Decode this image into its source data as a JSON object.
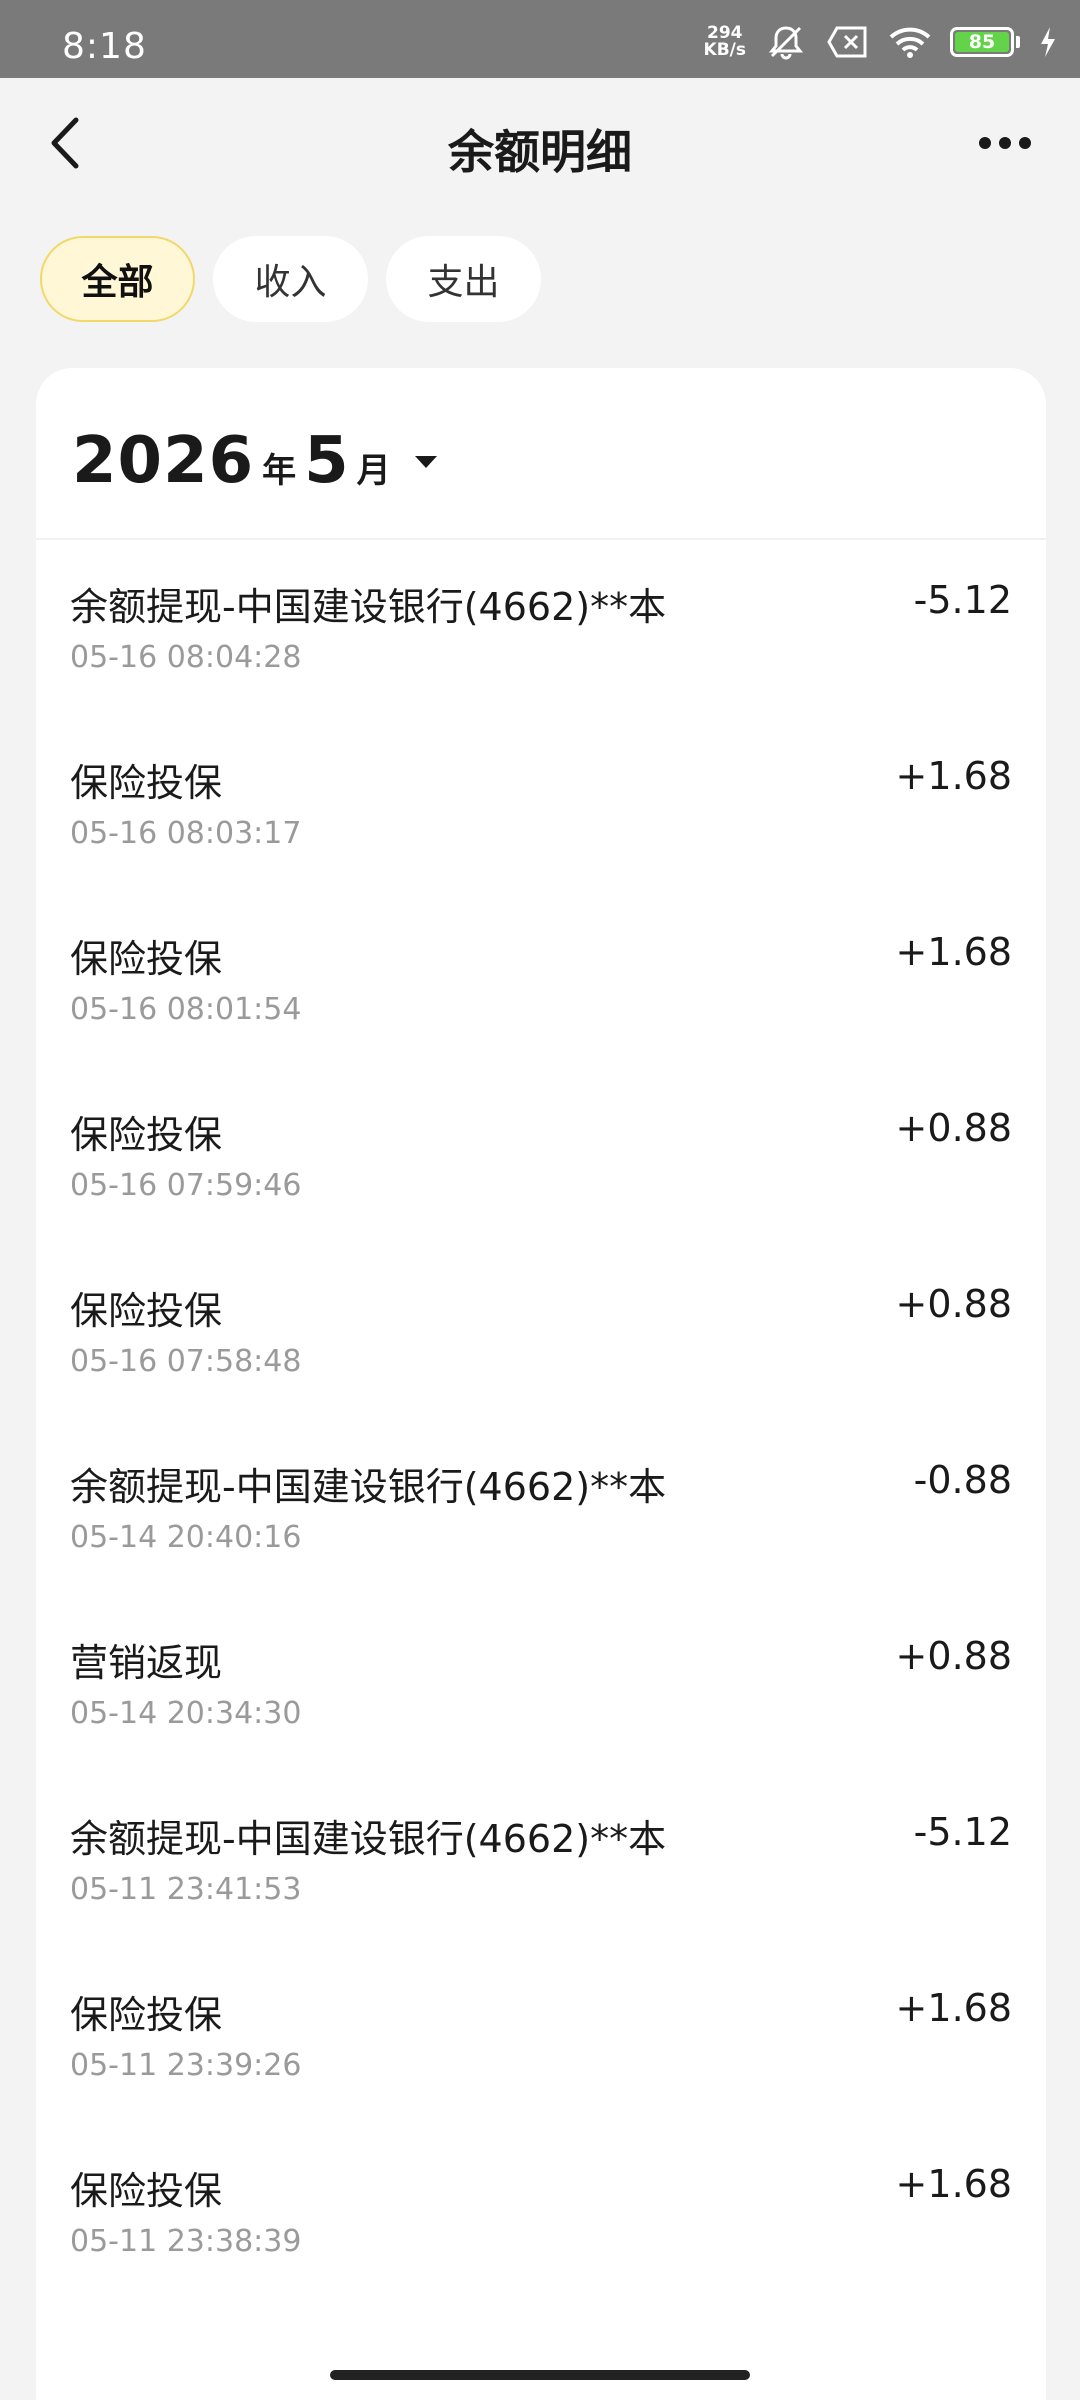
{
  "status_bar": {
    "time": "8:18",
    "speed_value": "294",
    "speed_unit": "KB/s",
    "battery": "85",
    "icons": [
      "mute-icon",
      "sim-blocked-icon",
      "wifi-icon",
      "battery-icon",
      "charging-icon"
    ]
  },
  "header": {
    "title": "余额明细",
    "back_icon": "chevron-left-icon",
    "more_icon": "more-dots-icon"
  },
  "filters": {
    "items": [
      {
        "label": "全部",
        "active": true
      },
      {
        "label": "收入",
        "active": false
      },
      {
        "label": "支出",
        "active": false
      }
    ]
  },
  "month": {
    "year": "2026",
    "year_unit": "年",
    "month": "5",
    "month_unit": "月"
  },
  "transactions": [
    {
      "title": "余额提现-中国建设银行(4662)**本",
      "time": "05-16 08:04:28",
      "amount": "-5.12"
    },
    {
      "title": "保险投保",
      "time": "05-16 08:03:17",
      "amount": "+1.68"
    },
    {
      "title": "保险投保",
      "time": "05-16 08:01:54",
      "amount": "+1.68"
    },
    {
      "title": "保险投保",
      "time": "05-16 07:59:46",
      "amount": "+0.88"
    },
    {
      "title": "保险投保",
      "time": "05-16 07:58:48",
      "amount": "+0.88"
    },
    {
      "title": "余额提现-中国建设银行(4662)**本",
      "time": "05-14 20:40:16",
      "amount": "-0.88"
    },
    {
      "title": "营销返现",
      "time": "05-14 20:34:30",
      "amount": "+0.88"
    },
    {
      "title": "余额提现-中国建设银行(4662)**本",
      "time": "05-11 23:41:53",
      "amount": "-5.12"
    },
    {
      "title": "保险投保",
      "time": "05-11 23:39:26",
      "amount": "+1.68"
    },
    {
      "title": "保险投保",
      "time": "05-11 23:38:39",
      "amount": "+1.68"
    }
  ]
}
